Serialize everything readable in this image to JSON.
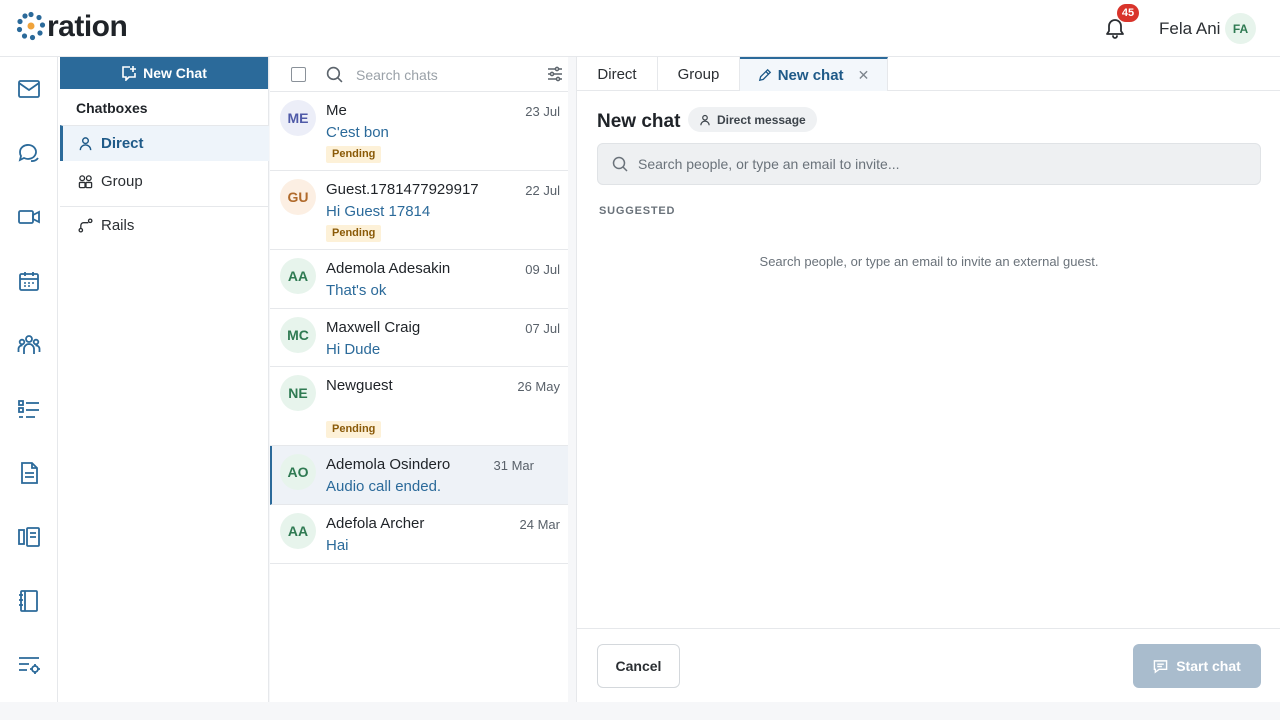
{
  "brand": {
    "name": "ration"
  },
  "header": {
    "notifications_count": "45",
    "user_name": "Fela Ani",
    "user_initials": "FA"
  },
  "rail": {
    "icons": [
      "mail-icon",
      "chat-icon",
      "video-icon",
      "calendar-icon",
      "team-icon",
      "tasks-icon",
      "document-icon",
      "book-icon",
      "notebook-icon",
      "settings-list-icon"
    ]
  },
  "chatboxes": {
    "new_chat_label": "New Chat",
    "title": "Chatboxes",
    "items": [
      {
        "label": "Direct",
        "icon": "person-icon",
        "active": true
      },
      {
        "label": "Group",
        "icon": "group-icon",
        "active": false
      },
      {
        "label": "Rails",
        "icon": "rails-icon",
        "active": false
      }
    ]
  },
  "chat_list": {
    "search_placeholder": "Search chats",
    "rows": [
      {
        "initials": "ME",
        "name": "Me",
        "date": "23 Jul",
        "message": "C'est bon",
        "badge": "Pending"
      },
      {
        "initials": "GU",
        "name": "Guest.1781477929917",
        "date": "22 Jul",
        "message": "Hi Guest 17814",
        "badge": "Pending"
      },
      {
        "initials": "AA",
        "name": "Ademola Adesakin",
        "date": "09 Jul",
        "message": "That's ok",
        "badge": ""
      },
      {
        "initials": "MC",
        "name": "Maxwell Craig",
        "date": "07 Jul",
        "message": "Hi Dude",
        "badge": ""
      },
      {
        "initials": "NE",
        "name": "Newguest",
        "date": "26 May",
        "message": "",
        "badge": "Pending"
      },
      {
        "initials": "AO",
        "name": "Ademola Osindero",
        "date": "31 Mar",
        "message": "Audio call ended.",
        "badge": ""
      },
      {
        "initials": "AA",
        "name": "Adefola Archer",
        "date": "24 Mar",
        "message": "Hai",
        "badge": ""
      }
    ]
  },
  "main": {
    "tabs": [
      {
        "label": "Direct"
      },
      {
        "label": "Group"
      },
      {
        "label": "New chat"
      }
    ],
    "title": "New chat",
    "mode_pill": "Direct message",
    "search_placeholder": "Search people, or type an email to invite...",
    "suggested_label": "SUGGESTED",
    "empty_message": "Search people, or type an email to invite an external guest.",
    "cancel_label": "Cancel",
    "start_label": "Start chat"
  },
  "colors": {
    "accent": "#2b6a9a",
    "badge_red": "#d9342b",
    "pending_bg": "#fdf1d8",
    "start_disabled": "#a9bccd"
  }
}
